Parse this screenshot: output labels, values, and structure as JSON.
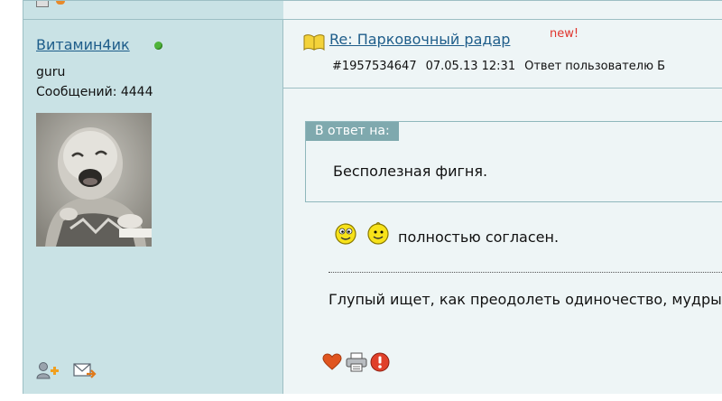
{
  "user": {
    "name": "Витамин4ик",
    "status": "online",
    "rank": "guru",
    "post_count": "Сообщений: 4444",
    "avatar": "baby-photo-avatar"
  },
  "post": {
    "title": "Re: Парковочный радар",
    "new_badge": "new!",
    "id": "#1957534647",
    "datetime": "07.05.13 12:31",
    "reply_to": "Ответ пользователю Б",
    "quote_label": "В ответ на:",
    "quote_text": "Бесполезная фигня.",
    "body_text": "полностью согласен.",
    "signature": "Глупый ищет, как преодолеть одиночество, мудрый"
  },
  "icons": {
    "user_actions": [
      "add-friend-icon",
      "private-message-icon"
    ],
    "post_actions": [
      "heart-icon",
      "print-icon",
      "report-icon"
    ],
    "smileys": [
      "smiley-icon",
      "smiley-icon"
    ],
    "title_icon": "book-icon"
  },
  "colors": {
    "user_pane_bg": "#c9e2e5",
    "post_pane_bg": "#eef5f6",
    "border": "#9dbfc4",
    "link": "#1e5d8a",
    "new_badge": "#e0342c",
    "quote_label_bg": "#7fa9ae",
    "online_dot": "#4fb43a"
  }
}
